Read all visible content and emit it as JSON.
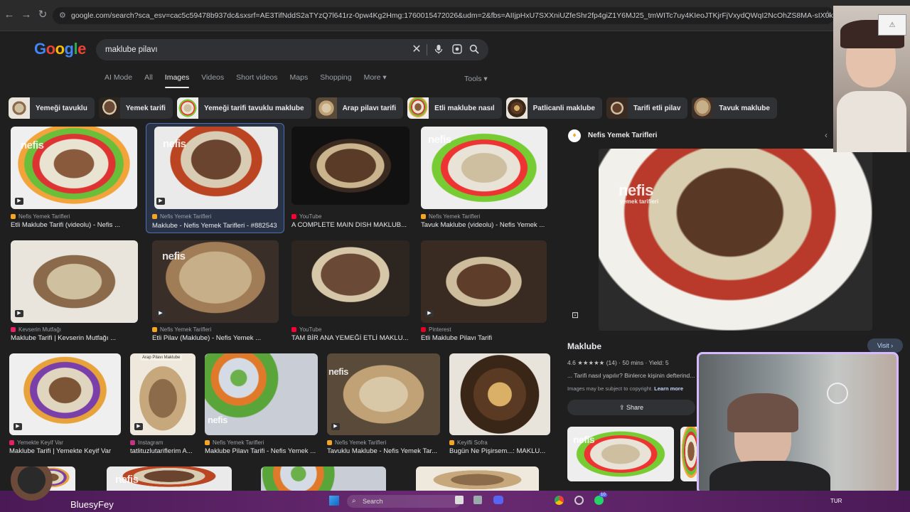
{
  "browser": {
    "url": "google.com/search?sca_esv=cac5c59478b937dc&sxsrf=AE3TifNddS2aTYzQ7l641rz-0pw4Kg2Hmg:1760015472026&udm=2&fbs=AIIjpHxU7SXXniUZfeShr2fp4giZ1Y6MJ25_tmWITc7uy4KIeoJTKjrFjVxydQWqI2NcOhZS8MA-sIX0k7PlasuZieEwMBJPsOLDTmy6S081eyur..."
  },
  "google": {
    "logo_text": "Google",
    "logo_colors": [
      "#4285f4",
      "#ea4335",
      "#fbbc05",
      "#4285f4",
      "#34a853",
      "#ea4335"
    ],
    "query": "maklube pilavı",
    "tabs": [
      {
        "label": "AI Mode"
      },
      {
        "label": "All"
      },
      {
        "label": "Images"
      },
      {
        "label": "Videos"
      },
      {
        "label": "Short videos"
      },
      {
        "label": "Maps"
      },
      {
        "label": "Shopping"
      },
      {
        "label": "More ▾"
      }
    ],
    "tools_label": "Tools ▾"
  },
  "chips": [
    {
      "label": "Yemeği tavuklu"
    },
    {
      "label": "Yemek tarifi"
    },
    {
      "label": "Yemeği tarifi tavuklu maklube"
    },
    {
      "label": "Arap pilavı tarifi"
    },
    {
      "label": "Etli maklube nasıl"
    },
    {
      "label": "Patlicanli maklube"
    },
    {
      "label": "Tarifi etli pilav"
    },
    {
      "label": "Tavuk maklube"
    }
  ],
  "results": [
    {
      "source": "Nefis Yemek Tarifleri",
      "title": "Etli Maklube Tarifi (videolu) - Nefis ..."
    },
    {
      "source": "Nefis Yemek Tarifleri",
      "title": "Maklube - Nefis Yemek Tarifleri - #882543"
    },
    {
      "source": "YouTube",
      "title": "A COMPLETE MAIN DISH MAKLUB..."
    },
    {
      "source": "Nefis Yemek Tarifleri",
      "title": "Tavuk Maklube (videolu) - Nefis Yemek ..."
    },
    {
      "source": "Kevserin Mutfağı",
      "title": "Maklube Tarifi | Kevserin Mutfağı ..."
    },
    {
      "source": "Nefis Yemek Tarifleri",
      "title": "Etli Pilav (Maklube) - Nefis Yemek ..."
    },
    {
      "source": "YouTube",
      "title": "TAM BİR ANA YEMEĞİ ETLİ MAKLU..."
    },
    {
      "source": "Pinterest",
      "title": "Etli Maklube Pilavı Tarifi"
    },
    {
      "source": "Yemekte Keyif Var",
      "title": "Maklube Tarifi | Yemekte Keyif Var"
    },
    {
      "source": "Instagram",
      "title": "tatlituzlutariflerim A..."
    },
    {
      "source": "Nefis Yemek Tarifleri",
      "title": "Maklube Pilavı Tarifi - Nefis Yemek ..."
    },
    {
      "source": "Nefis Yemek Tarifleri",
      "title": "Tavuklu Maklube - Nefis Yemek Tar..."
    },
    {
      "source": "Keyifli Sofra",
      "title": "Bugün Ne Pişirsem...: MAKLU..."
    }
  ],
  "watermarks": {
    "nefis": "nefis",
    "nefis_sub": "yemek tarifleri",
    "arap": "Arap Pilavı Maklube"
  },
  "panel": {
    "source": "Nefis Yemek Tarifleri",
    "title": "Maklube",
    "visit_label": "Visit ›",
    "rating": "4.6",
    "stars": "★★★★★",
    "reviews": "(14)",
    "time": "50 mins",
    "yield": "Yield: 5",
    "snippet": "... Tarifi nasıl yapılır? Binlerce kişinin defterind...",
    "copyright": "Images may be subject to copyright.",
    "learn_more": "Learn more",
    "share_label": "Share"
  },
  "taskbar": {
    "streamer_name": "BluesyFey",
    "search_placeholder": "Search",
    "lang": "TUR",
    "badge_count": "10"
  }
}
